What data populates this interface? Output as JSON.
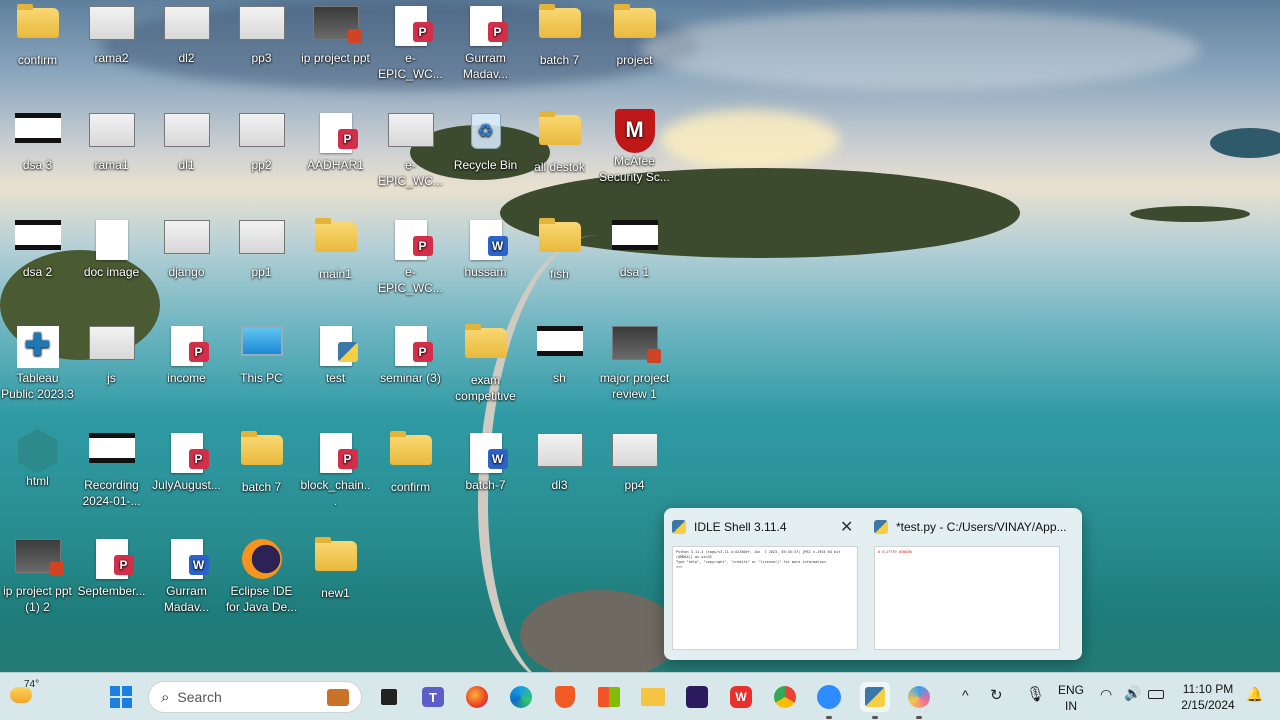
{
  "desktop_icons": [
    {
      "label": "confirm",
      "kind": "folder"
    },
    {
      "label": "rama2",
      "kind": "thumb"
    },
    {
      "label": "dl2",
      "kind": "thumb"
    },
    {
      "label": "pp3",
      "kind": "thumb"
    },
    {
      "label": "ip project ppt",
      "kind": "ppt"
    },
    {
      "label": "e-EPIC_WC...",
      "kind": "pdf"
    },
    {
      "label": "Gurram Madav...",
      "kind": "pdf"
    },
    {
      "label": "batch 7",
      "kind": "folder"
    },
    {
      "label": "project",
      "kind": "folder"
    },
    {
      "label": "dsa 3",
      "kind": "film"
    },
    {
      "label": "rama1",
      "kind": "thumb"
    },
    {
      "label": "dl1",
      "kind": "thumb"
    },
    {
      "label": "pp2",
      "kind": "thumb"
    },
    {
      "label": "AADHAR1",
      "kind": "pdf"
    },
    {
      "label": "e-EPIC_WC...",
      "kind": "thumb"
    },
    {
      "label": "Recycle Bin",
      "kind": "recycle"
    },
    {
      "label": "all destok",
      "kind": "folder"
    },
    {
      "label": "McAfee Security Sc...",
      "kind": "mcafee"
    },
    {
      "label": "dsa 2",
      "kind": "film"
    },
    {
      "label": "doc image",
      "kind": "doc"
    },
    {
      "label": "django",
      "kind": "thumb"
    },
    {
      "label": "pp1",
      "kind": "thumb"
    },
    {
      "label": "main1",
      "kind": "folder"
    },
    {
      "label": "e-EPIC_WC...",
      "kind": "pdf"
    },
    {
      "label": "hussam",
      "kind": "word"
    },
    {
      "label": "fish",
      "kind": "folder"
    },
    {
      "label": "dsa 1",
      "kind": "film"
    },
    {
      "label": "Tableau Public 2023.3",
      "kind": "tableau"
    },
    {
      "label": "js",
      "kind": "thumb"
    },
    {
      "label": "income",
      "kind": "pdf"
    },
    {
      "label": "This PC",
      "kind": "pc"
    },
    {
      "label": "test",
      "kind": "python"
    },
    {
      "label": "seminar (3)",
      "kind": "pdf"
    },
    {
      "label": "exam competitive",
      "kind": "folder"
    },
    {
      "label": "sh",
      "kind": "film"
    },
    {
      "label": "major project review 1",
      "kind": "ppt"
    },
    {
      "label": "html",
      "kind": "html"
    },
    {
      "label": "Recording 2024-01-...",
      "kind": "film"
    },
    {
      "label": "JulyAugust...",
      "kind": "pdf"
    },
    {
      "label": "batch 7",
      "kind": "folder"
    },
    {
      "label": "block_chain...",
      "kind": "pdf"
    },
    {
      "label": "confirm",
      "kind": "folder"
    },
    {
      "label": "batch-7",
      "kind": "word"
    },
    {
      "label": "dl3",
      "kind": "thumb"
    },
    {
      "label": "pp4",
      "kind": "thumb"
    },
    {
      "label": "ip project ppt (1) 2",
      "kind": "ppt"
    },
    {
      "label": "September...",
      "kind": "pdf"
    },
    {
      "label": "Gurram Madav...",
      "kind": "word"
    },
    {
      "label": "Eclipse IDE for Java De...",
      "kind": "eclipse"
    },
    {
      "label": "new1",
      "kind": "folder"
    }
  ],
  "preview": {
    "shell_title": "IDLE Shell 3.11.4",
    "editor_title": "*test.py - C:/Users/VINAY/App...",
    "shell_text": "Python 3.11.4 (tags/v3.11.4:d2340ef, Jun  7 2023, 05:45:37) [MSC v.1934 64 bit (AMD64)] on win32\nType \"help\", \"copyright\", \"credits\" or \"license()\" for more information.\n>>>",
    "editor_text": "# ELIFTRY WINDOW"
  },
  "taskbar": {
    "weather_temp": "74°",
    "search_placeholder": "Search",
    "lang_line1": "ENG",
    "lang_line2": "IN",
    "time": "11:10 PM",
    "date": "2/15/2024"
  }
}
